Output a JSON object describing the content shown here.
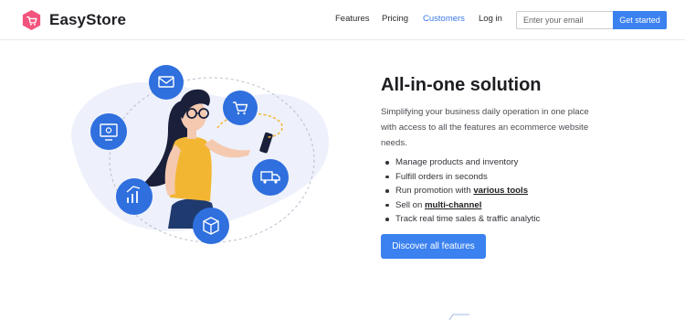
{
  "brand": {
    "name": "EasyStore",
    "logo_color": "#f2547d"
  },
  "nav": {
    "links": [
      {
        "label": "Features",
        "active": false
      },
      {
        "label": "Pricing",
        "active": false
      },
      {
        "label": "Customers",
        "active": true
      },
      {
        "label": "Log in",
        "active": false
      }
    ],
    "email_placeholder": "Enter your email",
    "get_started_label": "Get started"
  },
  "hero": {
    "title": "All-in-one solution",
    "description": "Simplifying your business daily operation in one place with access to all the features an ecommerce website needs.",
    "features": [
      {
        "text": "Manage products and inventory"
      },
      {
        "text": "Fulfill orders in seconds"
      },
      {
        "prefix": "Run promotion with ",
        "link": "various tools"
      },
      {
        "prefix": "Sell on ",
        "link": "multi-channel"
      },
      {
        "text": "Track real time sales & traffic analytic"
      }
    ],
    "cta_label": "Discover all features"
  },
  "illustration": {
    "icons": [
      "envelope-icon",
      "cart-icon",
      "delivery-truck-icon",
      "box-icon",
      "growth-chart-icon",
      "monitor-settings-icon"
    ]
  },
  "colors": {
    "accent": "#3b82f0",
    "icon_circle": "#2f6fde",
    "blob": "#eef1fb",
    "shirt": "#f2b632",
    "hair": "#1a1f3a"
  }
}
